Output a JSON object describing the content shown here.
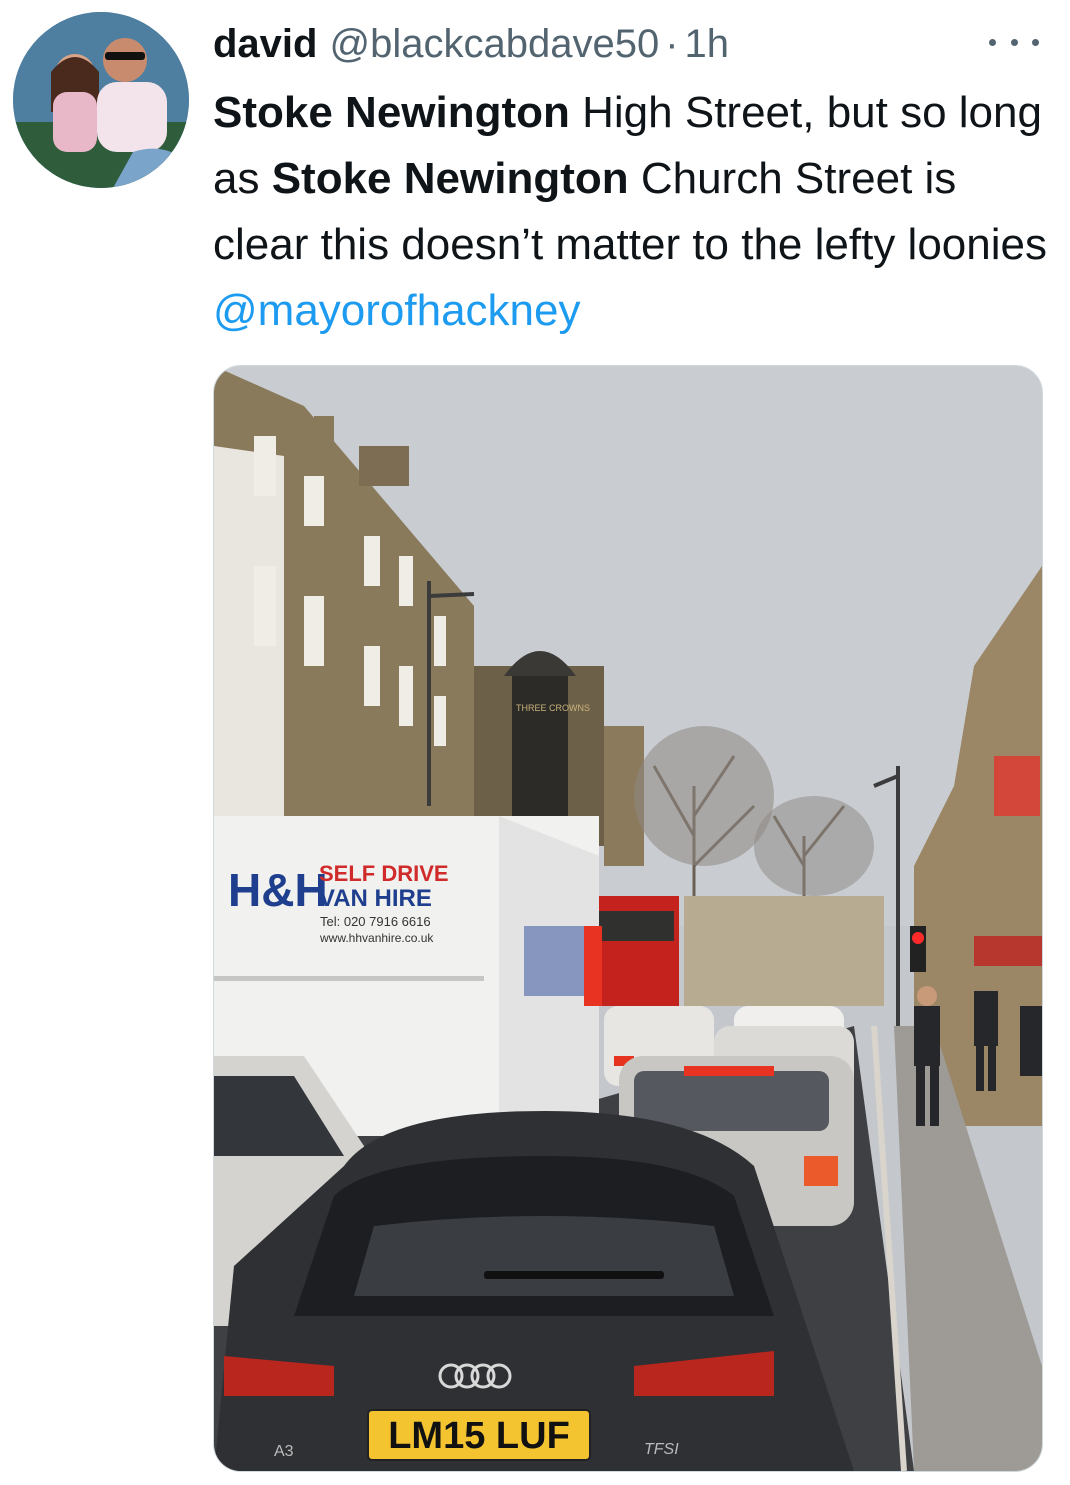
{
  "author": {
    "name": "david",
    "handle": "@blackcabdave50",
    "separator": "·",
    "time": "1h"
  },
  "tweet": {
    "seg1_bold": "Stoke Newington",
    "seg2": " High Street, but so long as ",
    "seg3_bold": "Stoke Newington",
    "seg4": " Church Street is clear this doesn’t matter to the lefty loonies ",
    "mention": "@mayorofhackney"
  },
  "photo": {
    "van_logo": "H&H",
    "van_line1": "SELF DRIVE",
    "van_line2": "VAN HIRE",
    "van_tel": "Tel: 020 7916 6616",
    "van_web": "www.hhvanhire.co.uk",
    "pub_sign": "THREE CROWNS",
    "plate": "LM15 LUF",
    "badge_left": "A3",
    "badge_right": "TFSI"
  },
  "colors": {
    "link": "#1d9bf0",
    "secondary": "#536471",
    "text": "#0f1419"
  }
}
